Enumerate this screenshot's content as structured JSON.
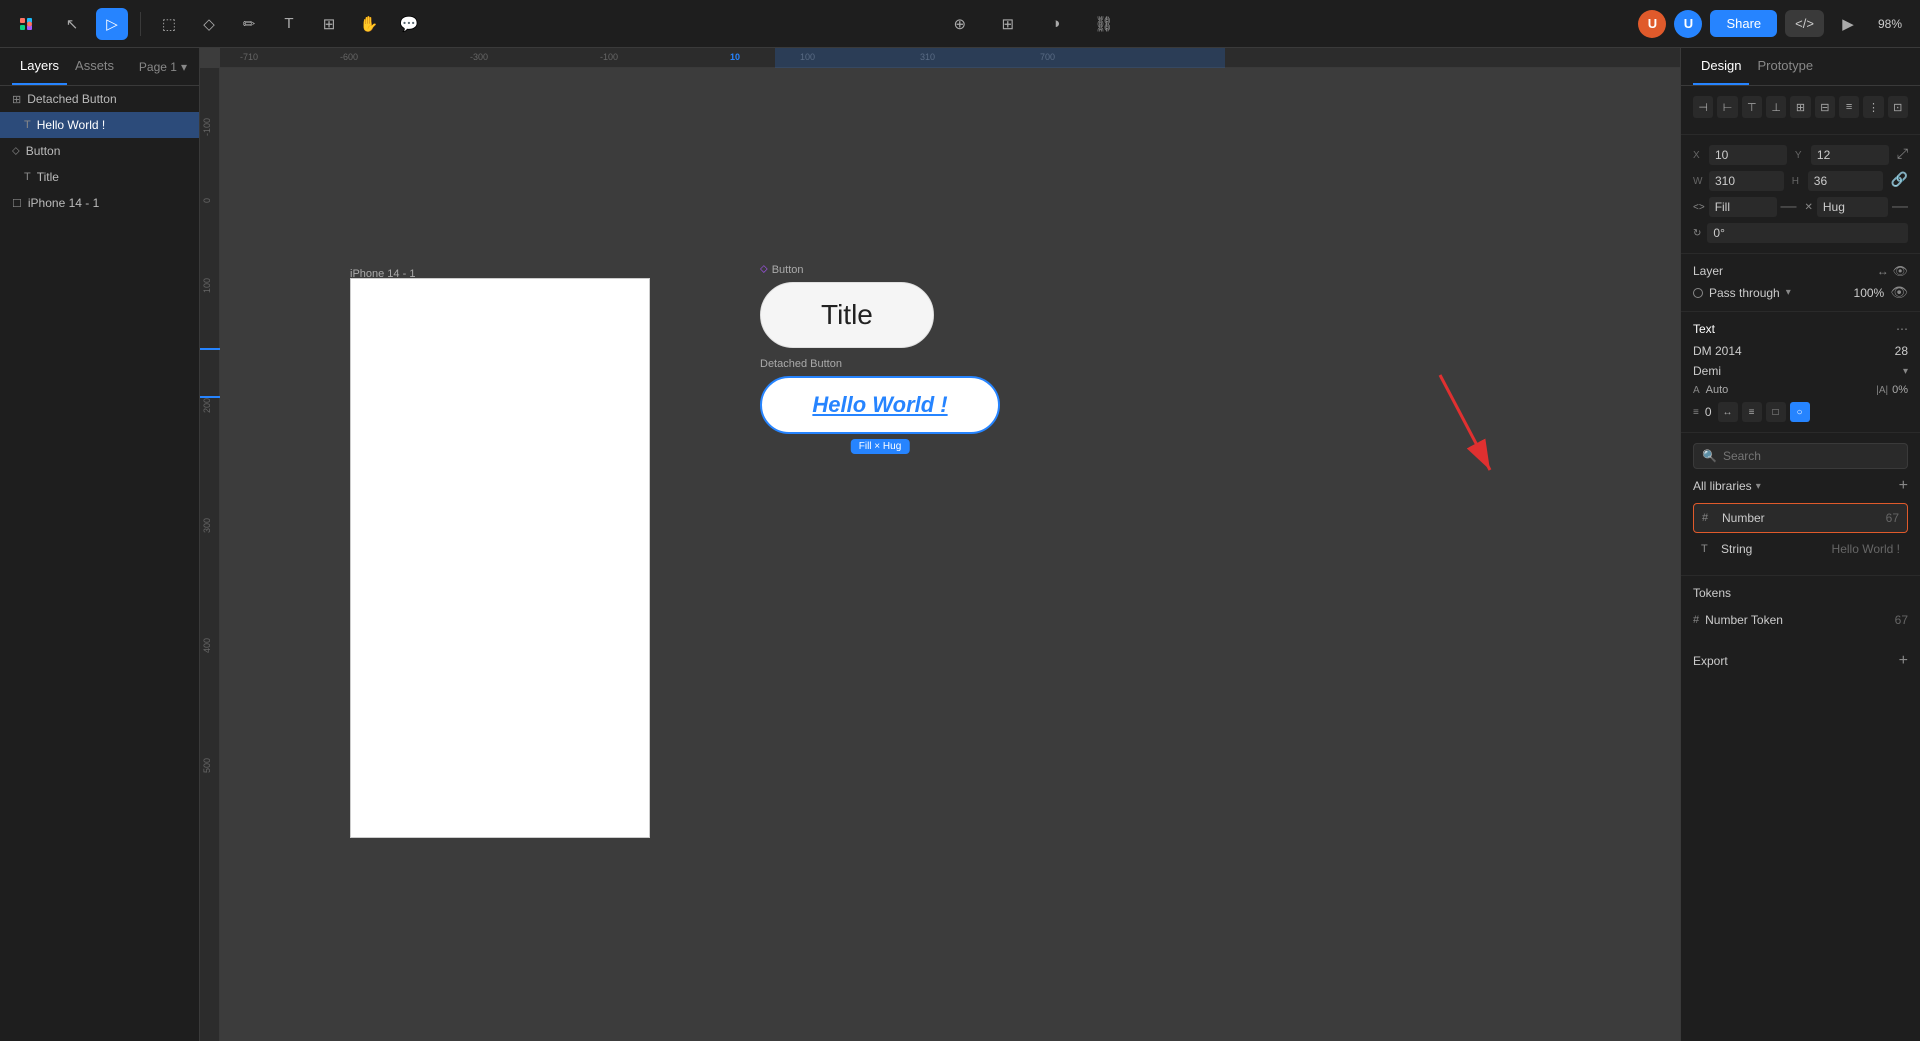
{
  "toolbar": {
    "logo": "F",
    "tools": [
      {
        "name": "move",
        "icon": "↖",
        "active": false
      },
      {
        "name": "select",
        "icon": "▷",
        "active": true
      },
      {
        "name": "frame",
        "icon": "⬚",
        "active": false
      },
      {
        "name": "shape",
        "icon": "◇",
        "active": false
      },
      {
        "name": "pen",
        "icon": "✏",
        "active": false
      },
      {
        "name": "text",
        "icon": "T",
        "active": false
      },
      {
        "name": "components",
        "icon": "⊞",
        "active": false
      },
      {
        "name": "hand",
        "icon": "✋",
        "active": false
      },
      {
        "name": "comment",
        "icon": "○",
        "active": false
      }
    ],
    "center_tools": [
      {
        "name": "inspect",
        "icon": "⊕"
      },
      {
        "name": "grid",
        "icon": "⊞"
      },
      {
        "name": "contrast",
        "icon": "◑"
      },
      {
        "name": "link",
        "icon": "⛓"
      }
    ],
    "share_label": "Share",
    "code_icon": "</>",
    "zoom_level": "98%",
    "avatar_initials": "U"
  },
  "left_panel": {
    "tabs": [
      {
        "label": "Layers",
        "active": true
      },
      {
        "label": "Assets",
        "active": false
      }
    ],
    "page_label": "Page 1",
    "layers": [
      {
        "indent": 0,
        "icon": "⊞",
        "label": "Detached Button",
        "active": false
      },
      {
        "indent": 1,
        "icon": "T",
        "label": "Hello World !",
        "active": true
      },
      {
        "indent": 0,
        "icon": "⬦",
        "label": "Button",
        "active": false
      },
      {
        "indent": 1,
        "icon": "T",
        "label": "Title",
        "active": false
      },
      {
        "indent": 0,
        "icon": "☐",
        "label": "iPhone 14 - 1",
        "active": false
      }
    ]
  },
  "canvas": {
    "iphone_frame_label": "iPhone 14 - 1",
    "button_group_label": "Button",
    "title_button_text": "Title",
    "detached_group_label": "Detached Button",
    "detached_button_text": "Hello World !",
    "fill_hug_badge": "Fill × Hug",
    "ruler_ticks_h": [
      "-710",
      "-600",
      "-300",
      "-100",
      "10",
      "100",
      "310",
      "700"
    ],
    "ruler_ticks_v": [
      "-100",
      "0",
      "100",
      "200",
      "300",
      "400",
      "500"
    ]
  },
  "right_panel": {
    "tabs": [
      {
        "label": "Design",
        "active": true
      },
      {
        "label": "Prototype",
        "active": false
      }
    ],
    "align": {
      "icons": [
        "⊣",
        "⊢",
        "⊤",
        "⊥",
        "⊞",
        "⊟"
      ]
    },
    "coords": {
      "x_label": "X",
      "x_value": "10",
      "y_label": "Y",
      "y_value": "12",
      "w_label": "W",
      "w_value": "310",
      "h_label": "H",
      "h_value": "36"
    },
    "props": {
      "fill_label": "Fill",
      "fill_value": "—",
      "hug_label": "Hug",
      "hug_value": "—",
      "rotation_label": "0°"
    },
    "layer": {
      "title": "Layer",
      "passthrough_label": "Pass through",
      "opacity": "100%"
    },
    "text": {
      "title": "Text",
      "font_name": "DM 2014",
      "font_weight": "Demi",
      "font_size": "28",
      "auto_label": "Auto",
      "percent_label": "0%",
      "spacing_value": "0"
    },
    "variables": {
      "title": "All libraries",
      "search_placeholder": "Search",
      "items": [
        {
          "type": "#",
          "name": "Number",
          "value": "67",
          "highlighted": true
        },
        {
          "type": "T",
          "name": "String",
          "value": "Hello World !"
        }
      ],
      "tokens_title": "Tokens",
      "tokens": [
        {
          "type": "#",
          "name": "Number Token",
          "value": "67"
        }
      ]
    },
    "export": {
      "label": "Export"
    }
  }
}
